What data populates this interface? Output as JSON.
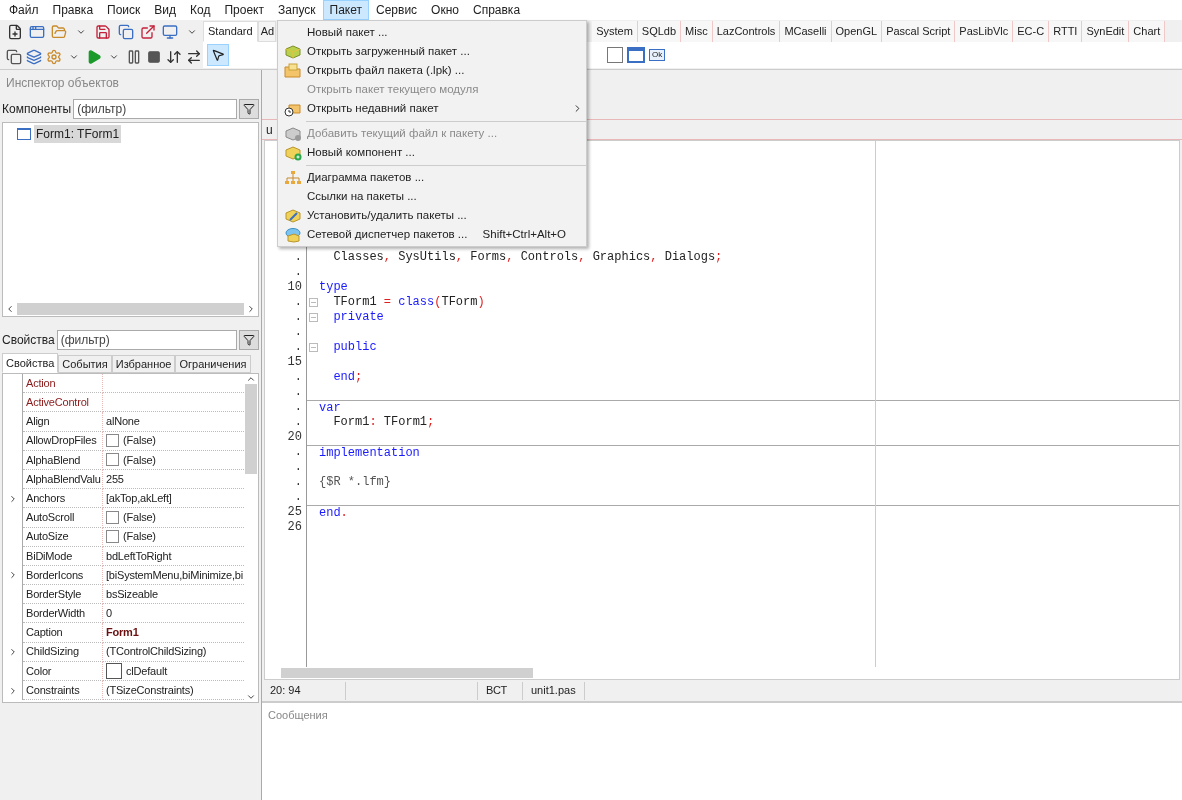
{
  "menubar": [
    {
      "label": "Файл",
      "selected": false
    },
    {
      "label": "Правка",
      "selected": false
    },
    {
      "label": "Поиск",
      "selected": false
    },
    {
      "label": "Вид",
      "selected": false
    },
    {
      "label": "Код",
      "selected": false
    },
    {
      "label": "Проект",
      "selected": false
    },
    {
      "label": "Запуск",
      "selected": false
    },
    {
      "label": "Пакет",
      "selected": true
    },
    {
      "label": "Сервис",
      "selected": false
    },
    {
      "label": "Окно",
      "selected": false
    },
    {
      "label": "Справка",
      "selected": false
    }
  ],
  "package_menu": [
    {
      "kind": "item",
      "label": "Новый пакет ...",
      "disabled": false,
      "submenu": false
    },
    {
      "kind": "item",
      "label": "Открыть загруженный пакет ...",
      "disabled": false,
      "submenu": false
    },
    {
      "kind": "item",
      "label": "Открыть файл пакета (.lpk) ...",
      "disabled": false,
      "submenu": false
    },
    {
      "kind": "item",
      "label": "Открыть пакет текущего модуля",
      "disabled": true,
      "submenu": false
    },
    {
      "kind": "item",
      "label": "Открыть недавний пакет",
      "disabled": false,
      "submenu": true
    },
    {
      "kind": "separator"
    },
    {
      "kind": "item",
      "label": "Добавить текущий файл к пакету ...",
      "disabled": true,
      "submenu": false
    },
    {
      "kind": "item",
      "label": "Новый компонент ...",
      "disabled": false,
      "submenu": false
    },
    {
      "kind": "separator"
    },
    {
      "kind": "item",
      "label": "Диаграмма пакетов ...",
      "disabled": false,
      "submenu": false
    },
    {
      "kind": "item",
      "label": "Ссылки на пакеты ...",
      "disabled": false,
      "submenu": false
    },
    {
      "kind": "item",
      "label": "Установить/удалить пакеты ...",
      "disabled": false,
      "submenu": false
    },
    {
      "kind": "item",
      "label": "Сетевой диспетчер пакетов ...",
      "disabled": false,
      "submenu": false,
      "shortcut": "Shift+Ctrl+Alt+O"
    }
  ],
  "palette": {
    "tabs_left": [
      {
        "label": "Standard",
        "selected": true
      },
      {
        "label": "Ad",
        "selected": false
      }
    ],
    "tabs_right": [
      {
        "label": "System",
        "selected": false
      },
      {
        "label": "SQLdb",
        "selected": false
      },
      {
        "label": "Misc",
        "selected": false
      },
      {
        "label": "LazControls",
        "selected": false
      },
      {
        "label": "MCaselli",
        "selected": false
      },
      {
        "label": "OpenGL",
        "selected": false
      },
      {
        "label": "Pascal Script",
        "selected": false
      },
      {
        "label": "PasLibVlc",
        "selected": false
      },
      {
        "label": "EC-C",
        "selected": false
      },
      {
        "label": "RTTI",
        "selected": false
      },
      {
        "label": "SynEdit",
        "selected": false
      },
      {
        "label": "Chart",
        "selected": false
      }
    ],
    "selector_selected": true,
    "ok_label": "Ok"
  },
  "inspector": {
    "title": "Инспектор объектов",
    "components_label": "Компоненты",
    "components_filter": {
      "placeholder": "(фильтр)"
    },
    "tree": [
      {
        "label": "Form1: TForm1",
        "selected": true
      }
    ],
    "properties_label": "Свойства",
    "properties_filter": {
      "placeholder": "(фильтр)"
    },
    "tabs": [
      {
        "label": "Свойства",
        "selected": true
      },
      {
        "label": "События",
        "selected": false
      },
      {
        "label": "Избранное",
        "selected": false
      },
      {
        "label": "Ограничения",
        "selected": false
      }
    ],
    "properties": [
      {
        "name": "Action",
        "kind": "text",
        "reference": true,
        "expandable": false
      },
      {
        "name": "ActiveControl",
        "kind": "text",
        "reference": true,
        "expandable": false
      },
      {
        "name": "Align",
        "value": "alNone",
        "kind": "text",
        "reference": false,
        "expandable": false,
        "modified": false
      },
      {
        "name": "AllowDropFiles",
        "value": "(False)",
        "kind": "checkbox",
        "reference": false,
        "expandable": false,
        "modified": false
      },
      {
        "name": "AlphaBlend",
        "value": "(False)",
        "kind": "checkbox",
        "reference": false,
        "expandable": false,
        "modified": false
      },
      {
        "name": "AlphaBlendValu",
        "value": "255",
        "kind": "text",
        "reference": false,
        "expandable": false,
        "modified": false
      },
      {
        "name": "Anchors",
        "value": "[akTop,akLeft]",
        "kind": "text",
        "reference": false,
        "expandable": true,
        "modified": false
      },
      {
        "name": "AutoScroll",
        "value": "(False)",
        "kind": "checkbox",
        "reference": false,
        "expandable": false,
        "modified": false
      },
      {
        "name": "AutoSize",
        "value": "(False)",
        "kind": "checkbox",
        "reference": false,
        "expandable": false,
        "modified": false
      },
      {
        "name": "BiDiMode",
        "value": "bdLeftToRight",
        "kind": "text",
        "reference": false,
        "expandable": false,
        "modified": false
      },
      {
        "name": "BorderIcons",
        "value": "[biSystemMenu,biMinimize,bi",
        "kind": "text",
        "reference": false,
        "expandable": true,
        "modified": false
      },
      {
        "name": "BorderStyle",
        "value": "bsSizeable",
        "kind": "text",
        "reference": false,
        "expandable": false,
        "modified": false
      },
      {
        "name": "BorderWidth",
        "value": "0",
        "kind": "text",
        "reference": false,
        "expandable": false,
        "modified": false
      },
      {
        "name": "Caption",
        "value": "Form1",
        "kind": "text",
        "reference": false,
        "expandable": false,
        "modified": true
      },
      {
        "name": "ChildSizing",
        "value": "(TControlChildSizing)",
        "kind": "text",
        "reference": false,
        "expandable": true,
        "modified": false
      },
      {
        "name": "Color",
        "value": "clDefault",
        "kind": "color",
        "reference": false,
        "expandable": false,
        "modified": false
      },
      {
        "name": "Constraints",
        "value": "(TSizeConstraints)",
        "kind": "text",
        "reference": false,
        "expandable": true,
        "modified": false
      }
    ]
  },
  "editor": {
    "tab": "u",
    "lines": [
      {
        "number": ".",
        "collapsible": false,
        "divider": false,
        "tokens": [
          {
            "text": "  Classes",
            "kind": "identifier"
          },
          {
            "text": ",",
            "kind": "symbol"
          },
          {
            "text": " SysUtils",
            "kind": "identifier"
          },
          {
            "text": ",",
            "kind": "symbol"
          },
          {
            "text": " Forms",
            "kind": "identifier"
          },
          {
            "text": ",",
            "kind": "symbol"
          },
          {
            "text": " Controls",
            "kind": "identifier"
          },
          {
            "text": ",",
            "kind": "symbol"
          },
          {
            "text": " Graphics",
            "kind": "identifier"
          },
          {
            "text": ",",
            "kind": "symbol"
          },
          {
            "text": " Dialogs",
            "kind": "identifier"
          },
          {
            "text": ";",
            "kind": "symbol"
          }
        ]
      },
      {
        "number": ".",
        "collapsible": false,
        "divider": false
      },
      {
        "number": "10",
        "collapsible": false,
        "divider": false,
        "tokens": [
          {
            "text": "type",
            "kind": "keyword"
          }
        ]
      },
      {
        "number": ".",
        "collapsible": true,
        "divider": false,
        "tokens": [
          {
            "text": "  TForm1 ",
            "kind": "identifier"
          },
          {
            "text": "=",
            "kind": "symbol"
          },
          {
            "text": " class",
            "kind": "keyword"
          },
          {
            "text": "(",
            "kind": "symbol"
          },
          {
            "text": "TForm",
            "kind": "identifier"
          },
          {
            "text": ")",
            "kind": "symbol"
          }
        ]
      },
      {
        "number": ".",
        "collapsible": true,
        "divider": false,
        "tokens": [
          {
            "text": "  private",
            "kind": "keyword"
          }
        ]
      },
      {
        "number": ".",
        "collapsible": false,
        "divider": false
      },
      {
        "number": ".",
        "collapsible": true,
        "divider": false,
        "tokens": [
          {
            "text": "  public",
            "kind": "keyword"
          }
        ]
      },
      {
        "number": "15",
        "collapsible": false,
        "divider": false
      },
      {
        "number": ".",
        "collapsible": false,
        "divider": false,
        "tokens": [
          {
            "text": "  end",
            "kind": "keyword"
          },
          {
            "text": ";",
            "kind": "symbol"
          }
        ]
      },
      {
        "number": ".",
        "collapsible": false,
        "divider": false
      },
      {
        "number": ".",
        "collapsible": false,
        "divider": true,
        "tokens": [
          {
            "text": "var",
            "kind": "keyword"
          }
        ]
      },
      {
        "number": ".",
        "collapsible": false,
        "divider": false,
        "tokens": [
          {
            "text": "  Form1",
            "kind": "identifier"
          },
          {
            "text": ":",
            "kind": "symbol"
          },
          {
            "text": " TForm1",
            "kind": "identifier"
          },
          {
            "text": ";",
            "kind": "symbol"
          }
        ]
      },
      {
        "number": "20",
        "collapsible": false,
        "divider": false
      },
      {
        "number": ".",
        "collapsible": false,
        "divider": true,
        "tokens": [
          {
            "text": "implementation",
            "kind": "keyword"
          }
        ]
      },
      {
        "number": ".",
        "collapsible": false,
        "divider": false
      },
      {
        "number": ".",
        "collapsible": false,
        "divider": false,
        "tokens": [
          {
            "text": "{$R *.lfm}",
            "kind": "comment"
          }
        ]
      },
      {
        "number": ".",
        "collapsible": false,
        "divider": false
      },
      {
        "number": "25",
        "collapsible": false,
        "divider": true,
        "tokens": [
          {
            "text": "end",
            "kind": "keyword"
          },
          {
            "text": ".",
            "kind": "symbol"
          }
        ]
      },
      {
        "number": "26",
        "collapsible": false,
        "divider": false
      }
    ]
  },
  "status_bar": {
    "position": "20: 94",
    "mode": "ВСТ",
    "file": "unit1.pas"
  },
  "messages": {
    "title": "Сообщения"
  }
}
